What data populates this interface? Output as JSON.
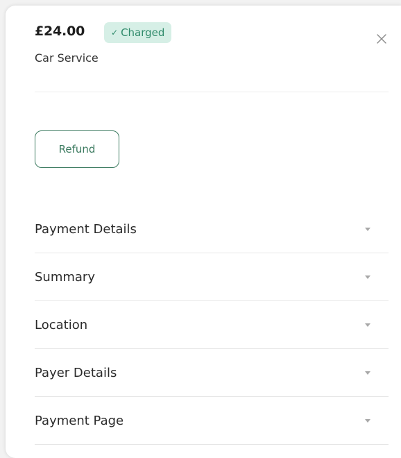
{
  "transaction": {
    "amount": "£24.00",
    "status": "Charged",
    "status_color": "#2f8a6a",
    "status_bg": "#d6efe6",
    "description": "Car Service"
  },
  "actions": {
    "refund_label": "Refund"
  },
  "sections": [
    {
      "label": "Payment Details",
      "icon": "chevron-down-icon"
    },
    {
      "label": "Summary",
      "icon": "chevron-down-icon"
    },
    {
      "label": "Location",
      "icon": "chevron-down-icon"
    },
    {
      "label": "Payer Details",
      "icon": "chevron-down-icon"
    },
    {
      "label": "Payment Page",
      "icon": "chevron-down-icon"
    }
  ],
  "icons": {
    "close": "close-icon",
    "status": "check-icon"
  },
  "colors": {
    "accent": "#3b7a5f"
  }
}
